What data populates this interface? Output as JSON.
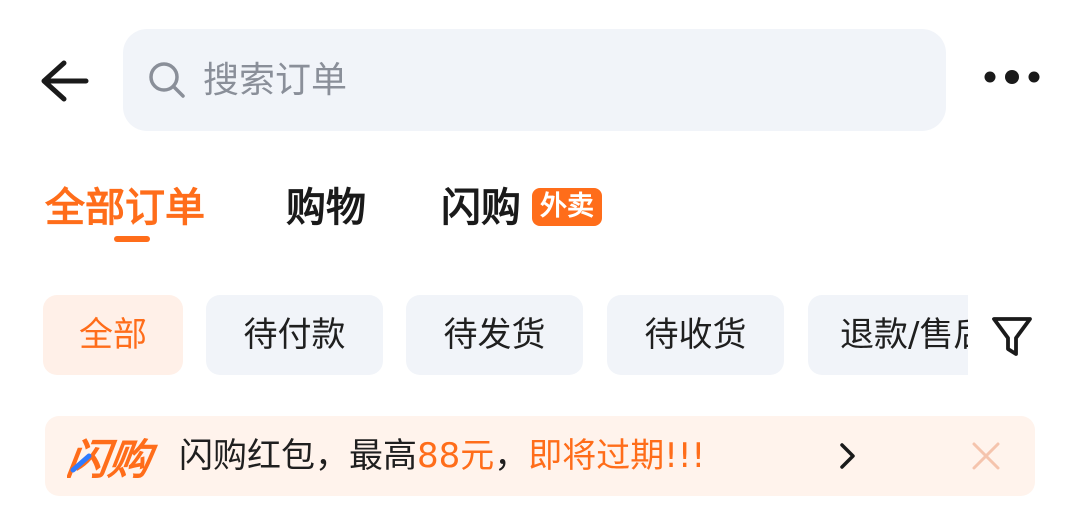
{
  "search": {
    "placeholder": "搜索订单",
    "value": ""
  },
  "header": {
    "back_icon": "arrow-left-icon",
    "more_icon": "more-dots-icon"
  },
  "tabs": [
    {
      "label": "全部订单",
      "active": true
    },
    {
      "label": "购物",
      "active": false
    },
    {
      "label": "闪购",
      "active": false,
      "badge": "外卖"
    }
  ],
  "filters": [
    {
      "label": "全部",
      "active": true
    },
    {
      "label": "待付款",
      "active": false
    },
    {
      "label": "待发货",
      "active": false
    },
    {
      "label": "待收货",
      "active": false
    },
    {
      "label": "退款/售后",
      "active": false
    }
  ],
  "filter_icon": "funnel-icon",
  "banner": {
    "logo_text": "闪购",
    "text_part1": "闪购红包，最高",
    "text_amount": "88元",
    "text_part2": "，",
    "text_expiring": "即将过期!!!",
    "chevron_icon": "chevron-right-icon",
    "close_icon": "close-icon"
  },
  "colors": {
    "accent": "#ff6d1a",
    "chip_bg": "#f1f4f9",
    "chip_active_bg": "#fff0e8",
    "banner_bg": "#fff3ec",
    "text": "#1f1f1f",
    "placeholder": "#8a8f99"
  }
}
